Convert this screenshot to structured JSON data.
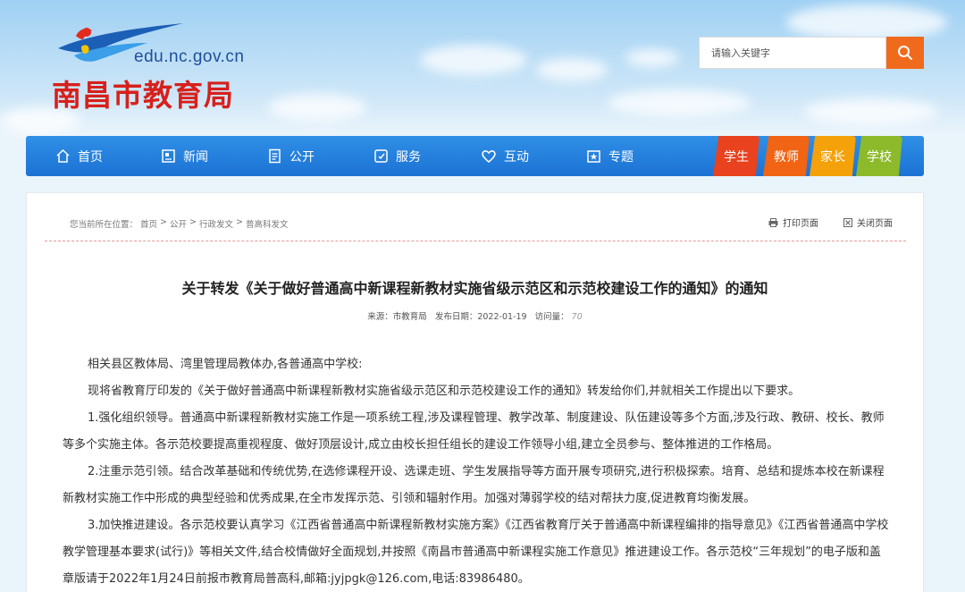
{
  "header": {
    "site_domain": "edu.nc.gov.cn",
    "site_title": "南昌市教育局",
    "search": {
      "placeholder": "请输入关键字",
      "button_icon": "search-icon"
    }
  },
  "nav": {
    "items": [
      {
        "label": "首页",
        "icon": "home-icon"
      },
      {
        "label": "新闻",
        "icon": "news-icon"
      },
      {
        "label": "公开",
        "icon": "document-icon"
      },
      {
        "label": "服务",
        "icon": "service-icon"
      },
      {
        "label": "互动",
        "icon": "heart-icon"
      },
      {
        "label": "专题",
        "icon": "topic-icon"
      }
    ],
    "tabs": [
      {
        "label": "学生",
        "color": "#e8421e"
      },
      {
        "label": "教师",
        "color": "#f06414"
      },
      {
        "label": "家长",
        "color": "#f5a10a"
      },
      {
        "label": "学校",
        "color": "#8cba2a"
      }
    ]
  },
  "article": {
    "breadcrumb": {
      "prefix": "您当前所在位置：",
      "items": [
        "首页",
        "公开",
        "行政发文",
        "普高科发文"
      ],
      "separator": ">"
    },
    "print_label": "打印页面",
    "close_label": "关闭页面",
    "title": "关于转发《关于做好普通高中新课程新教材实施省级示范区和示范校建设工作的通知》的通知",
    "meta": {
      "source_label": "来源：",
      "source": "市教育局",
      "date_label": "发布日期：",
      "date": "2022-01-19",
      "visits_label": "访问量：",
      "visits": "70"
    },
    "paragraphs": [
      "相关县区教体局、湾里管理局教体办,各普通高中学校:",
      "现将省教育厅印发的《关于做好普通高中新课程新教材实施省级示范区和示范校建设工作的通知》转发给你们,并就相关工作提出以下要求。",
      "1.强化组织领导。普通高中新课程新教材实施工作是一项系统工程,涉及课程管理、教学改革、制度建设、队伍建设等多个方面,涉及行政、教研、校长、教师等多个实施主体。各示范校要提高重视程度、做好顶层设计,成立由校长担任组长的建设工作领导小组,建立全员参与、整体推进的工作格局。",
      "2.注重示范引领。结合改革基础和传统优势,在选修课程开设、选课走班、学生发展指导等方面开展专项研究,进行积极探索。培育、总结和提炼本校在新课程新教材实施工作中形成的典型经验和优秀成果,在全市发挥示范、引领和辐射作用。加强对薄弱学校的结对帮扶力度,促进教育均衡发展。",
      "3.加快推进建设。各示范校要认真学习《江西省普通高中新课程新教材实施方案》《江西省教育厅关于普通高中新课程编排的指导意见》《江西省普通高中学校教学管理基本要求(试行)》等相关文件,结合校情做好全面规划,并按照《南昌市普通高中新课程实施工作意见》推进建设工作。各示范校“三年规划”的电子版和盖章版请于2022年1月24日前报市教育局普高科,邮箱:jyjpgk@126.com,电话:83986480。"
    ]
  }
}
